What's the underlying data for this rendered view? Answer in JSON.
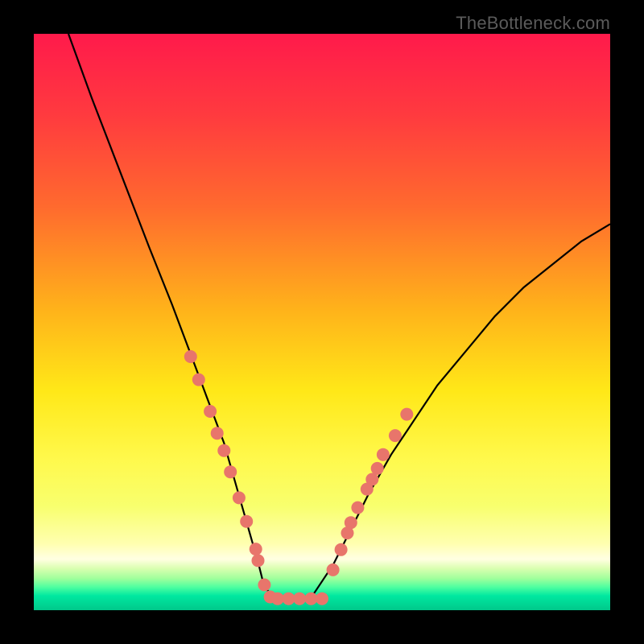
{
  "watermark": "TheBottleneck.com",
  "chart_data": {
    "type": "line",
    "title": "",
    "xlabel": "",
    "ylabel": "",
    "xlim": [
      0,
      100
    ],
    "ylim": [
      0,
      100
    ],
    "grid": false,
    "legend": false,
    "series": [
      {
        "name": "bottleneck-curve",
        "x": [
          6,
          10,
          15,
          20,
          24,
          27,
          30,
          33,
          35,
          37,
          39,
          40,
          42,
          44,
          48,
          52,
          55,
          58,
          62,
          66,
          70,
          75,
          80,
          85,
          90,
          95,
          100
        ],
        "y": [
          100,
          89,
          76,
          63,
          53,
          45,
          37,
          29,
          22,
          15,
          8,
          4,
          2,
          2,
          2,
          8,
          14,
          20,
          27,
          33,
          39,
          45,
          51,
          56,
          60,
          64,
          67
        ],
        "stroke": "#000000",
        "stroke_width": 2.2
      }
    ],
    "markers": {
      "name": "highlight-dots",
      "points": [
        {
          "x": 27.2,
          "y": 44.0
        },
        {
          "x": 28.6,
          "y": 40.0
        },
        {
          "x": 30.6,
          "y": 34.5
        },
        {
          "x": 31.8,
          "y": 30.7
        },
        {
          "x": 33.0,
          "y": 27.7
        },
        {
          "x": 34.1,
          "y": 24.0
        },
        {
          "x": 35.6,
          "y": 19.5
        },
        {
          "x": 36.9,
          "y": 15.4
        },
        {
          "x": 38.5,
          "y": 10.6
        },
        {
          "x": 38.9,
          "y": 8.6
        },
        {
          "x": 40.0,
          "y": 4.4
        },
        {
          "x": 41.0,
          "y": 2.3
        },
        {
          "x": 42.3,
          "y": 2.0
        },
        {
          "x": 44.2,
          "y": 2.0
        },
        {
          "x": 46.1,
          "y": 2.0
        },
        {
          "x": 48.1,
          "y": 2.0
        },
        {
          "x": 50.0,
          "y": 2.0
        },
        {
          "x": 51.9,
          "y": 7.0
        },
        {
          "x": 53.3,
          "y": 10.5
        },
        {
          "x": 54.4,
          "y": 13.4
        },
        {
          "x": 55.0,
          "y": 15.2
        },
        {
          "x": 56.2,
          "y": 17.8
        },
        {
          "x": 57.8,
          "y": 21.0
        },
        {
          "x": 58.7,
          "y": 22.7
        },
        {
          "x": 59.6,
          "y": 24.6
        },
        {
          "x": 60.6,
          "y": 27.0
        },
        {
          "x": 62.7,
          "y": 30.3
        },
        {
          "x": 64.7,
          "y": 34.0
        }
      ],
      "fill": "#e8756b",
      "radius": 8
    },
    "gradient_stops": [
      {
        "pos": 0.0,
        "color": "#ff1a4b"
      },
      {
        "pos": 0.14,
        "color": "#ff3a3f"
      },
      {
        "pos": 0.3,
        "color": "#ff6a2e"
      },
      {
        "pos": 0.48,
        "color": "#ffb31a"
      },
      {
        "pos": 0.62,
        "color": "#ffe818"
      },
      {
        "pos": 0.74,
        "color": "#fff94d"
      },
      {
        "pos": 0.82,
        "color": "#f8ff6e"
      },
      {
        "pos": 0.885,
        "color": "#ffffb0"
      },
      {
        "pos": 0.912,
        "color": "#ffffe0"
      },
      {
        "pos": 0.928,
        "color": "#d9ffb0"
      },
      {
        "pos": 0.945,
        "color": "#a0ff9c"
      },
      {
        "pos": 0.96,
        "color": "#4effa0"
      },
      {
        "pos": 0.975,
        "color": "#00e8a0"
      },
      {
        "pos": 1.0,
        "color": "#00c88a"
      }
    ]
  }
}
